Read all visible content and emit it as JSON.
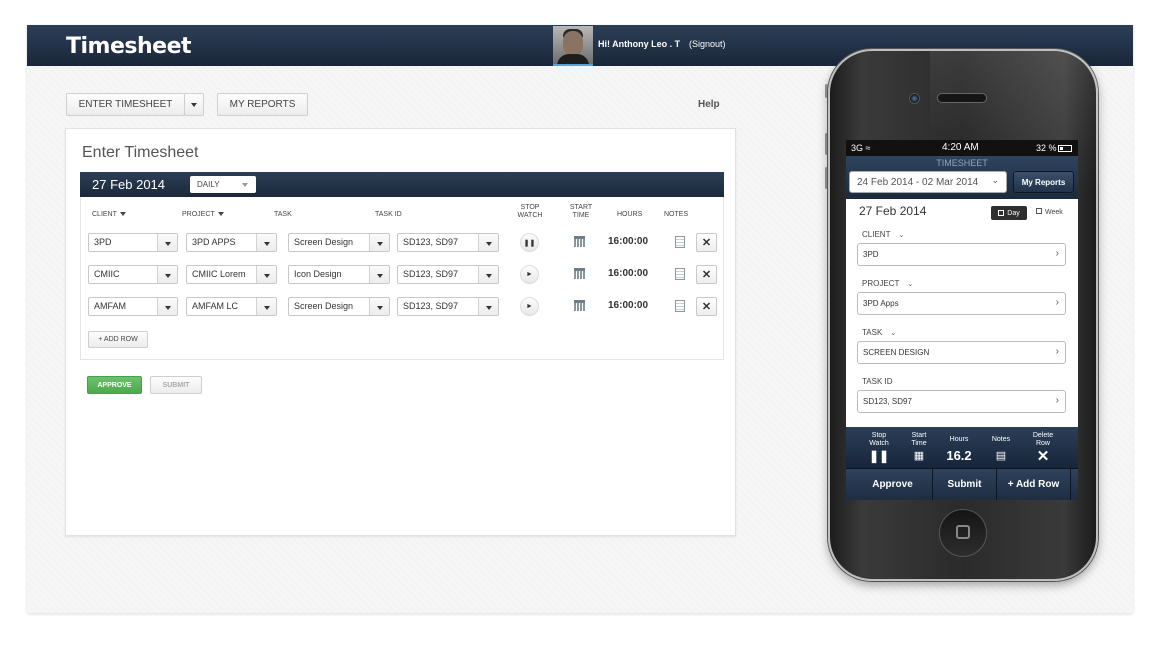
{
  "header": {
    "brand": "Timesheet",
    "greeting": "Hi! Anthony Leo . T",
    "signout": "(Signout)"
  },
  "toolbar": {
    "enter_timesheet": "ENTER TIMESHEET",
    "my_reports": "MY REPORTS",
    "help": "Help"
  },
  "panel": {
    "title": "Enter Timesheet",
    "date": "27 Feb 2014",
    "period": "DAILY"
  },
  "columns": {
    "client": "CLIENT",
    "project": "PROJECT",
    "task": "TASK",
    "task_id": "TASK ID",
    "stop_watch_1": "STOP",
    "stop_watch_2": "WATCH",
    "start_time_1": "START",
    "start_time_2": "TIME",
    "hours": "HOURS",
    "notes": "NOTES"
  },
  "rows": [
    {
      "client": "3PD",
      "project": "3PD APPS",
      "task": "Screen Design",
      "task_id": "SD123, SD97",
      "hours": "16:00:00",
      "stopwatch": "pause"
    },
    {
      "client": "CMIIC",
      "project": "CMIIC Lorem",
      "task": "Icon Design",
      "task_id": "SD123, SD97",
      "hours": "16:00:00",
      "stopwatch": "play"
    },
    {
      "client": "AMFAM",
      "project": "AMFAM LC",
      "task": "Screen Design",
      "task_id": "SD123, SD97",
      "hours": "16:00:00",
      "stopwatch": "play"
    }
  ],
  "actions": {
    "add_row": "+ ADD ROW",
    "approve": "APPROVE",
    "submit": "SUBMIT"
  },
  "colors": {
    "header_navy": "#1a273a",
    "approve_green": "#4ea84e"
  },
  "mobile": {
    "status": {
      "carrier": "3G",
      "time": "4:20 AM",
      "battery": "32 %"
    },
    "title": "TIMESHEET",
    "range": "24 Feb 2014 - 02 Mar 2014",
    "my_reports": "My Reports",
    "date": "27 Feb 2014",
    "day": "Day",
    "week": "Week",
    "fields": [
      {
        "label": "CLIENT",
        "value": "3PD"
      },
      {
        "label": "PROJECT",
        "value": "3PD Apps"
      },
      {
        "label": "TASK",
        "value": "SCREEN DESIGN"
      },
      {
        "label": "TASK ID",
        "value": "SD123, SD97"
      }
    ],
    "tools": {
      "stop_watch_1": "Stop",
      "stop_watch_2": "Watch",
      "start_time_1": "Start",
      "start_time_2": "Time",
      "hours": "Hours",
      "hours_value": "16.2",
      "notes": "Notes",
      "delete_1": "Delete",
      "delete_2": "Row"
    },
    "actions": {
      "approve": "Approve",
      "submit": "Submit",
      "add_row": "+ Add Row"
    }
  }
}
